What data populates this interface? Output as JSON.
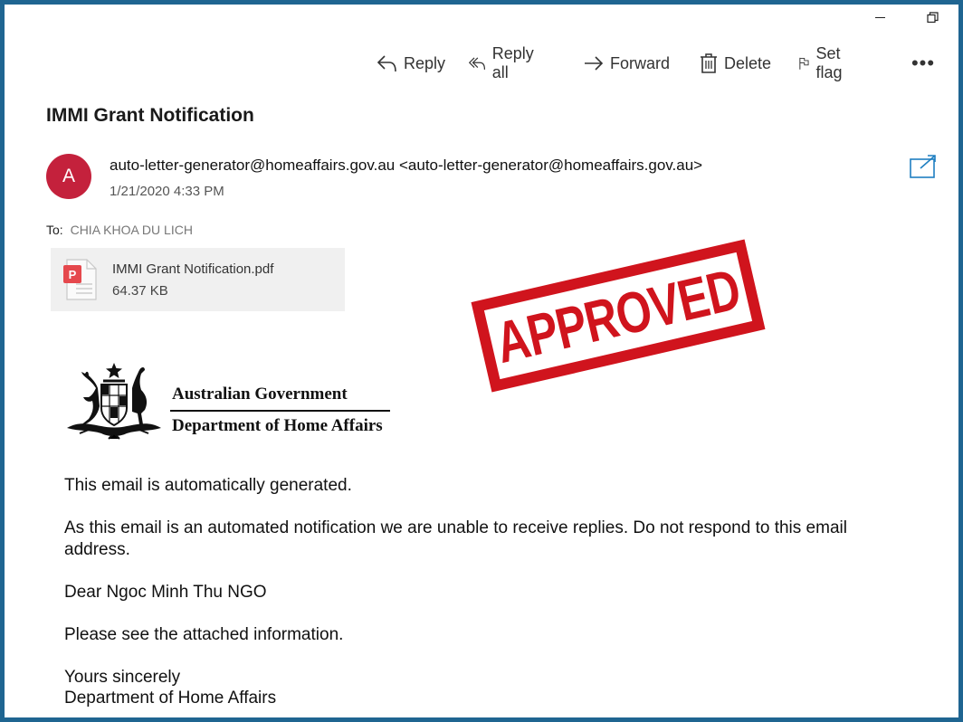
{
  "window": {
    "minimize_icon": "minimize-icon",
    "restore_icon": "restore-icon"
  },
  "toolbar": {
    "reply": "Reply",
    "reply_all": "Reply all",
    "forward": "Forward",
    "delete": "Delete",
    "set_flag": "Set flag",
    "more": "•••"
  },
  "message": {
    "subject": "IMMI Grant Notification",
    "avatar_letter": "A",
    "sender_name": "auto-letter-generator@homeaffairs.gov.au",
    "sender_email": "<auto-letter-generator@homeaffairs.gov.au>",
    "date": "1/21/2020 4:33 PM",
    "to_label": "To:",
    "to_value": "CHIA KHOA DU LICH",
    "attachment": {
      "name": "IMMI Grant Notification.pdf",
      "size": "64.37 KB"
    }
  },
  "stamp": {
    "text": "APPROVED"
  },
  "logo": {
    "line1": "Australian Government",
    "line2": "Department of Home Affairs"
  },
  "body": {
    "p1": "This email is automatically generated.",
    "p2": "As this email is an automated notification we are unable to receive replies. Do not respond to this email address.",
    "p3": "Dear Ngoc Minh Thu NGO",
    "p4": "Please see the attached information.",
    "p5_line1": "Yours sincerely",
    "p5_line2": "Department of Home Affairs"
  },
  "colors": {
    "frame": "#1f6591",
    "avatar": "#c4213c",
    "stamp": "#d0141d",
    "accent": "#1f7fc1"
  }
}
